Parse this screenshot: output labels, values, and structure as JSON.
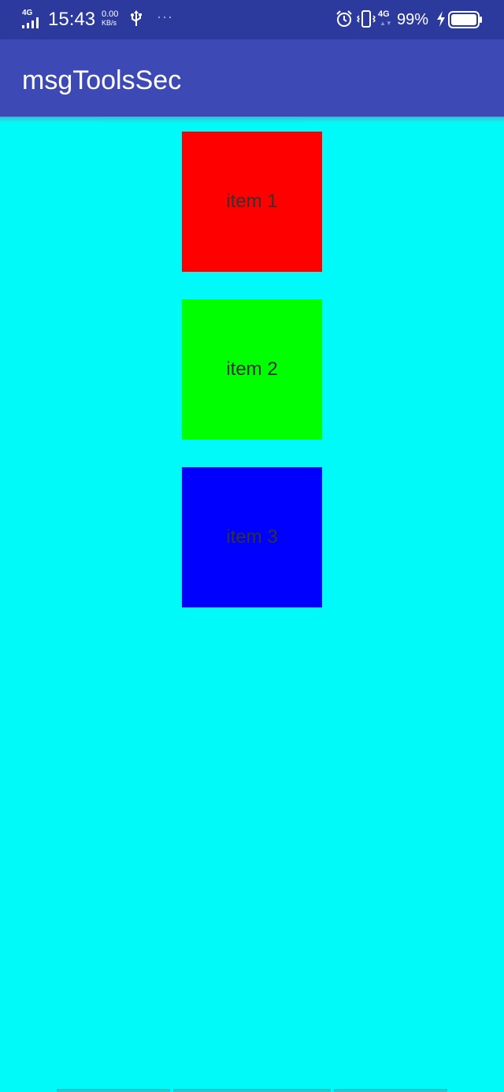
{
  "status_bar": {
    "network": "4G",
    "time": "15:43",
    "speed_value": "0.00",
    "speed_unit": "KB/s",
    "overflow": "···",
    "network_right": "4G",
    "battery_percent": "99%",
    "icons": [
      "signal-icon",
      "usb-icon",
      "alarm-icon",
      "vibrate-icon",
      "charging-icon",
      "battery-icon"
    ]
  },
  "app_bar": {
    "title": "msgToolsSec"
  },
  "items": [
    {
      "label": "item 1",
      "color": "#FF0000"
    },
    {
      "label": "item 2",
      "color": "#00FF00"
    },
    {
      "label": "item 3",
      "color": "#0000FF"
    }
  ],
  "colors": {
    "status_bar": "#2C3A9E",
    "app_bar": "#3D4AB5",
    "background": "#00FAF9"
  }
}
